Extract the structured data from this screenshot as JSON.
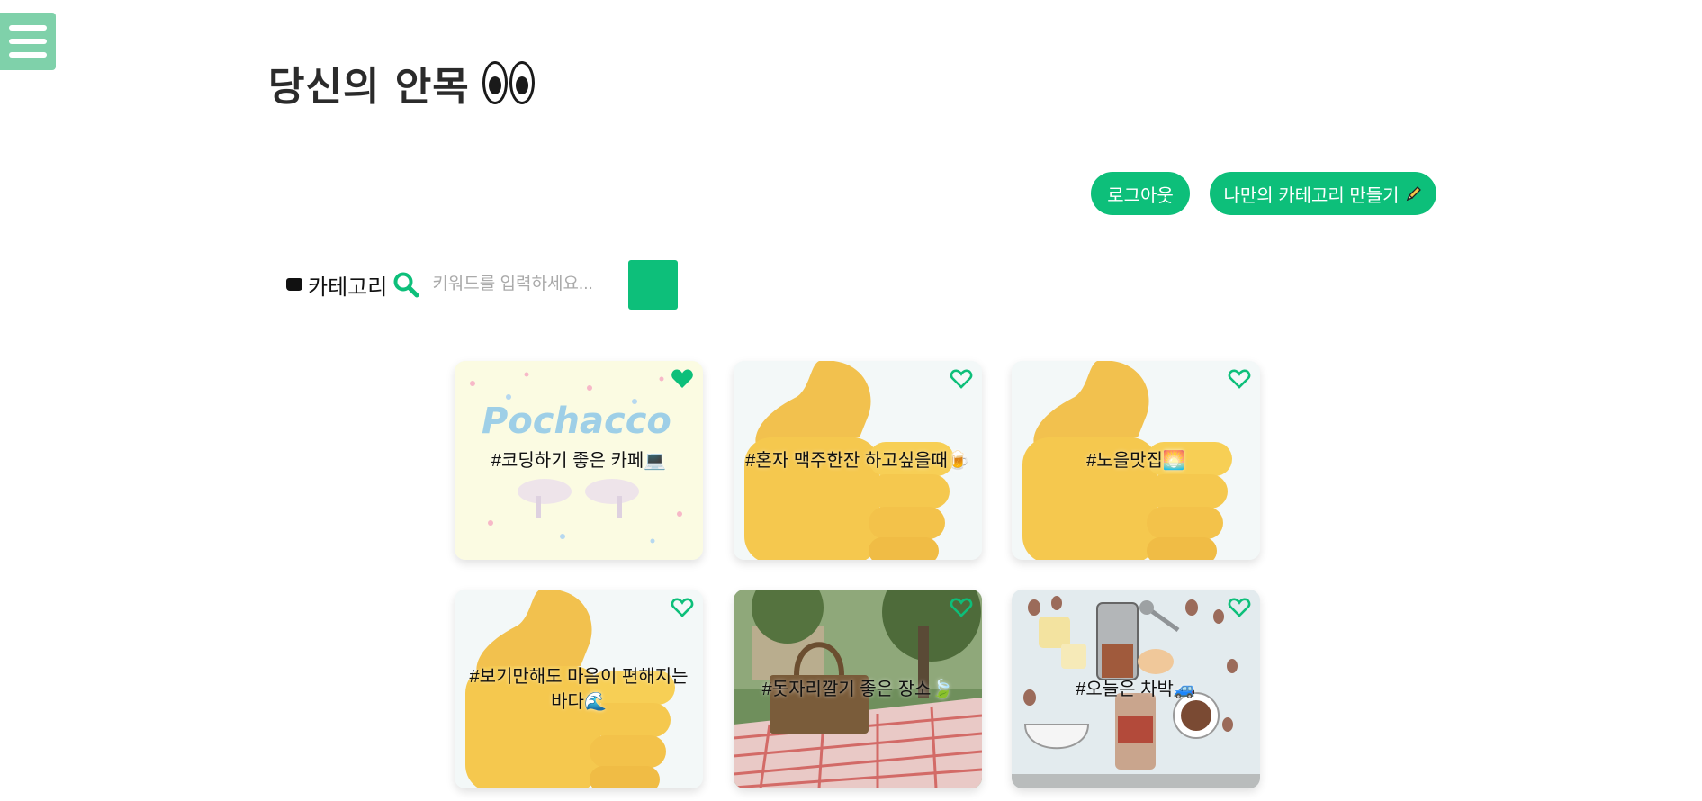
{
  "app": {
    "title": "당신의 안목"
  },
  "header": {
    "logout_label": "로그아웃",
    "make_category_label": "나만의 카테고리 만들기"
  },
  "search": {
    "category_label": "카테고리",
    "placeholder": "키워드를 입력하세요..."
  },
  "colors": {
    "accent": "#0dbf7a",
    "menu": "#7fd1aa"
  },
  "cards": [
    {
      "title": "#코딩하기 좋은 카페💻",
      "liked": true,
      "background": "pochacco-illustration"
    },
    {
      "title": "#혼자 맥주한잔 하고싶을때🍺",
      "liked": false,
      "background": "thumbs-up-emoji"
    },
    {
      "title": "#노을맛집🌅",
      "liked": false,
      "background": "thumbs-up-emoji"
    },
    {
      "title": "#보기만해도 마음이 편해지는 바다🌊",
      "liked": false,
      "background": "thumbs-up-emoji"
    },
    {
      "title": "#돗자리깔기 좋은 장소🍃",
      "liked": false,
      "background": "picnic-photo"
    },
    {
      "title": "#오늘은 차박🚙",
      "liked": false,
      "background": "coffee-illustration"
    }
  ]
}
